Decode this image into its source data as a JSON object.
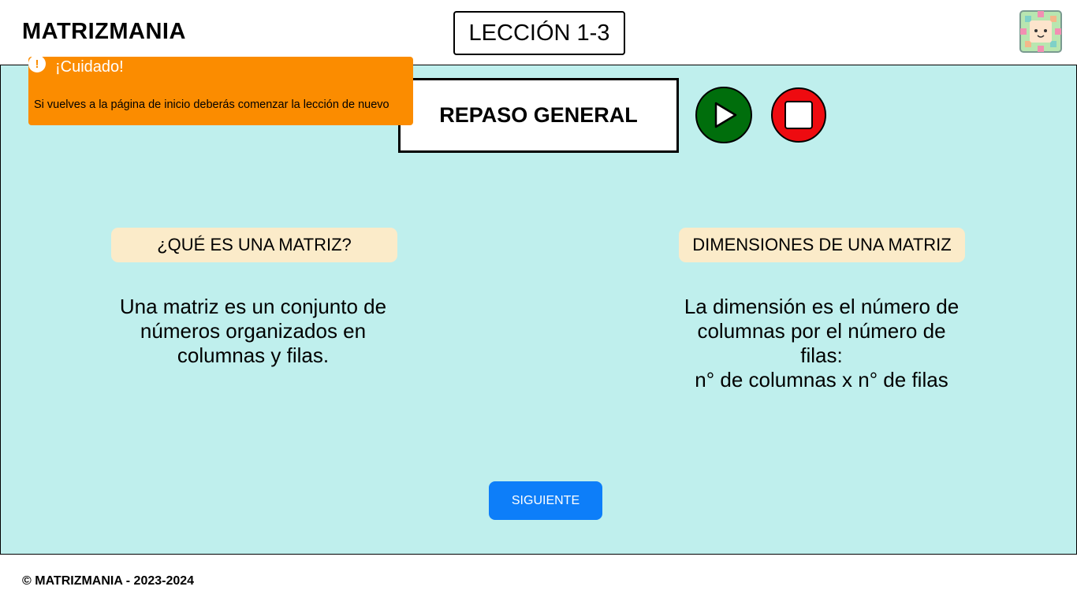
{
  "header": {
    "brand": "MATRIZMANIA",
    "lesson": "LECCIÓN 1-3",
    "mascot_icon": "pixel-face-mascot-icon"
  },
  "toast": {
    "title": "¡Cuidado!",
    "message": "Si vuelves a la página de inicio deberás comenzar la lección de nuevo",
    "icon": "exclamation-icon",
    "color": "#fb8c00"
  },
  "main": {
    "title": "REPASO GENERAL",
    "play_icon": "play-icon",
    "stop_icon": "stop-icon",
    "sections": [
      {
        "heading": "¿QUÉ ES UNA MATRIZ?",
        "body": "Una matriz es un conjunto de\nnúmeros organizados en\ncolumnas y filas."
      },
      {
        "heading": "DIMENSIONES DE UNA MATRIZ",
        "body": "La dimensión es el número de\ncolumnas por el número de\nfilas:\nn° de columnas x n° de filas"
      }
    ],
    "next_label": "SIGUIENTE"
  },
  "footer": {
    "copyright": "© MATRIZMANIA - 2023-2024"
  },
  "colors": {
    "stage_bg": "#bfefed",
    "pill_bg": "#fbebc9",
    "play": "#006e0c",
    "stop": "#ee0b10",
    "primary_button": "#0d7ef9"
  }
}
